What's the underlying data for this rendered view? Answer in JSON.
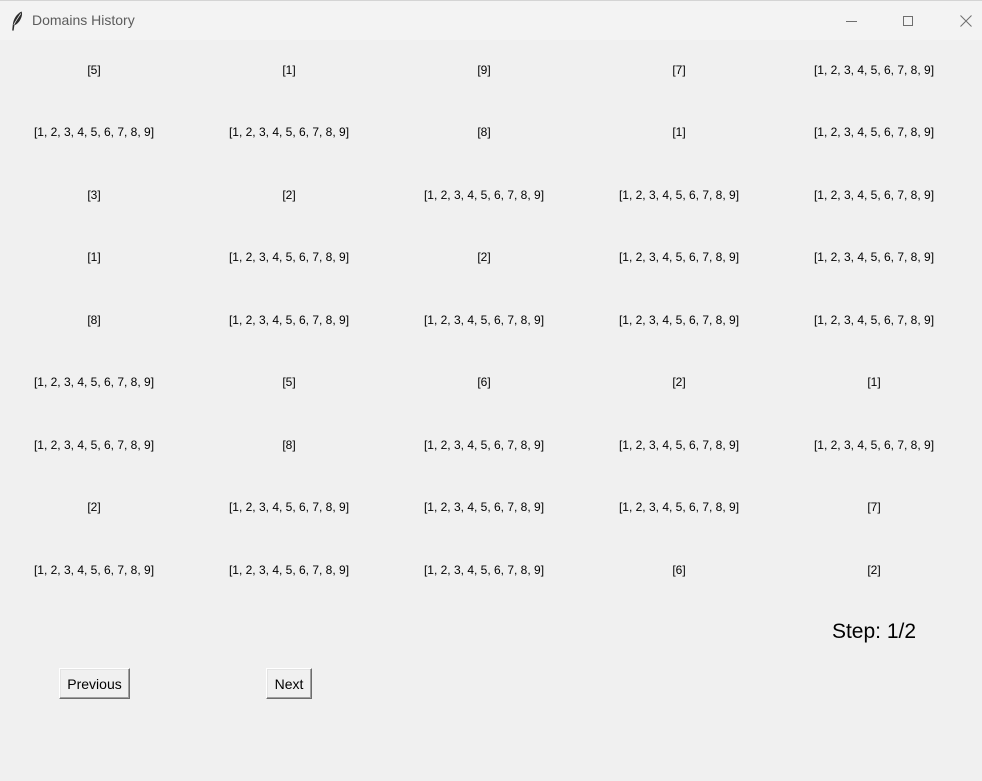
{
  "window": {
    "title": "Domains History",
    "controls": [
      "minimize",
      "maximize",
      "close"
    ]
  },
  "grid": [
    [
      "[5]",
      "[1]",
      "[9]",
      "[7]",
      "[1, 2, 3, 4, 5, 6, 7, 8, 9]"
    ],
    [
      "[1, 2, 3, 4, 5, 6, 7, 8, 9]",
      "[1, 2, 3, 4, 5, 6, 7, 8, 9]",
      "[8]",
      "[1]",
      "[1, 2, 3, 4, 5, 6, 7, 8, 9]"
    ],
    [
      "[3]",
      "[2]",
      "[1, 2, 3, 4, 5, 6, 7, 8, 9]",
      "[1, 2, 3, 4, 5, 6, 7, 8, 9]",
      "[1, 2, 3, 4, 5, 6, 7, 8, 9]"
    ],
    [
      "[1]",
      "[1, 2, 3, 4, 5, 6, 7, 8, 9]",
      "[2]",
      "[1, 2, 3, 4, 5, 6, 7, 8, 9]",
      "[1, 2, 3, 4, 5, 6, 7, 8, 9]"
    ],
    [
      "[8]",
      "[1, 2, 3, 4, 5, 6, 7, 8, 9]",
      "[1, 2, 3, 4, 5, 6, 7, 8, 9]",
      "[1, 2, 3, 4, 5, 6, 7, 8, 9]",
      "[1, 2, 3, 4, 5, 6, 7, 8, 9]"
    ],
    [
      "[1, 2, 3, 4, 5, 6, 7, 8, 9]",
      "[5]",
      "[6]",
      "[2]",
      "[1]"
    ],
    [
      "[1, 2, 3, 4, 5, 6, 7, 8, 9]",
      "[8]",
      "[1, 2, 3, 4, 5, 6, 7, 8, 9]",
      "[1, 2, 3, 4, 5, 6, 7, 8, 9]",
      "[1, 2, 3, 4, 5, 6, 7, 8, 9]"
    ],
    [
      "[2]",
      "[1, 2, 3, 4, 5, 6, 7, 8, 9]",
      "[1, 2, 3, 4, 5, 6, 7, 8, 9]",
      "[1, 2, 3, 4, 5, 6, 7, 8, 9]",
      "[7]"
    ],
    [
      "[1, 2, 3, 4, 5, 6, 7, 8, 9]",
      "[1, 2, 3, 4, 5, 6, 7, 8, 9]",
      "[1, 2, 3, 4, 5, 6, 7, 8, 9]",
      "[6]",
      "[2]"
    ]
  ],
  "step": {
    "label": "Step: 1/2"
  },
  "buttons": {
    "previous": "Previous",
    "next": "Next"
  }
}
